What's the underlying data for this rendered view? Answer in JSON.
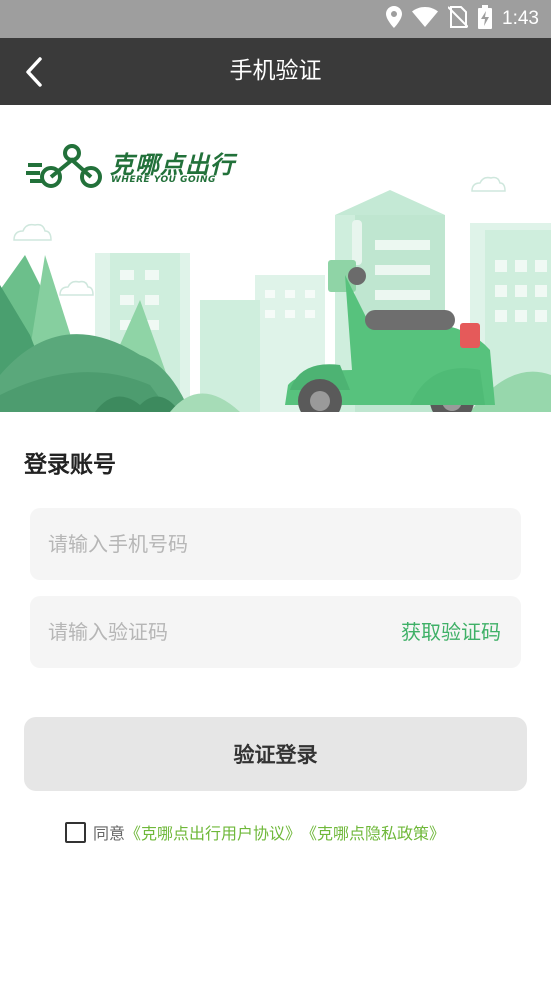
{
  "status": {
    "time": "1:43"
  },
  "header": {
    "title": "手机验证"
  },
  "brand": {
    "name": "克哪点出行",
    "tagline": "WHERE YOU GOING"
  },
  "form": {
    "section_title": "登录账号",
    "phone_placeholder": "请输入手机号码",
    "code_placeholder": "请输入验证码",
    "get_code_label": "获取验证码",
    "login_label": "验证登录"
  },
  "agreement": {
    "prefix": "同意",
    "user_agreement": "《克哪点出行用户协议》",
    "privacy_policy": "《克哪点隐私政策》"
  },
  "colors": {
    "accent_green": "#3fb067",
    "link_green": "#6fb83a",
    "brand_green": "#22713a",
    "title_bar": "#3a3a3a"
  }
}
